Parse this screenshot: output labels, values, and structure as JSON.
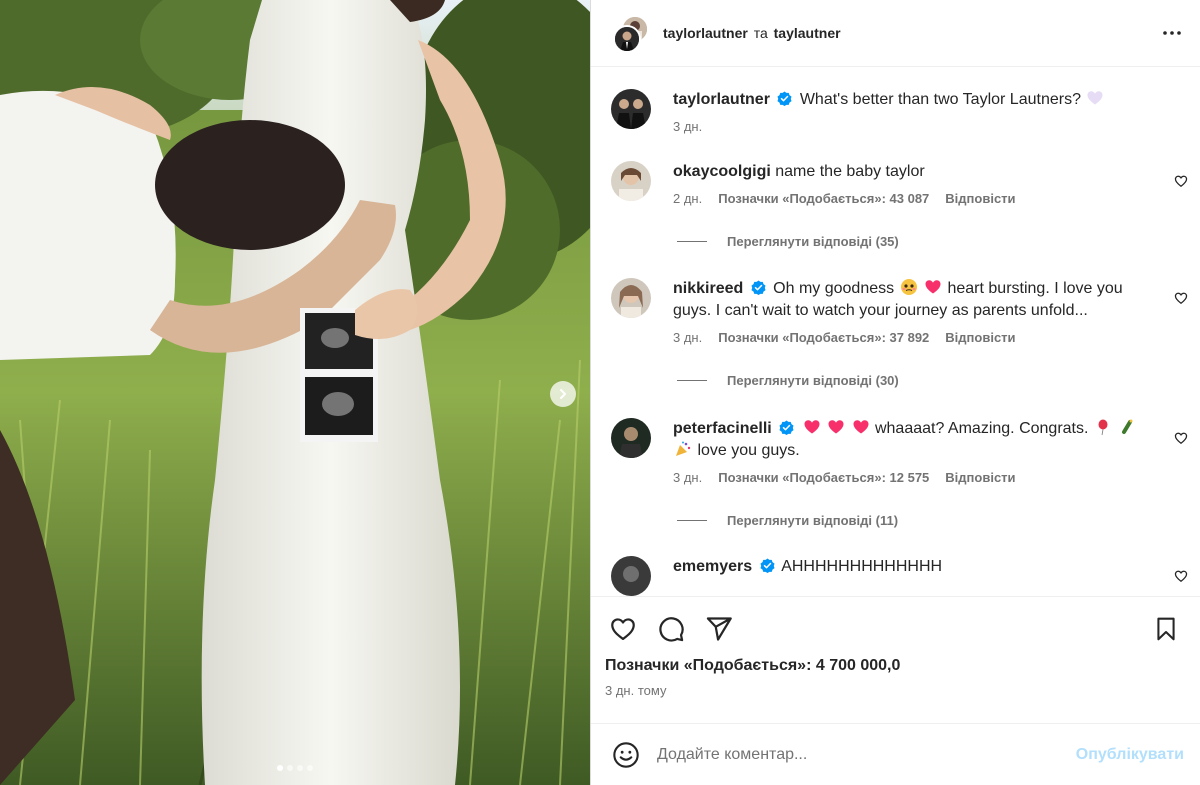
{
  "header": {
    "user1": "taylorlautner",
    "conjunction": "та",
    "user2": "taylautner",
    "more_icon": "more-horizontal-icon"
  },
  "caption": {
    "username": "taylorlautner",
    "text": "What's better than two Taylor Lautners?",
    "time": "3 дн."
  },
  "comments": [
    {
      "username": "okaycoolgigi",
      "verified": false,
      "text": "name the baby taylor",
      "time": "2 дн.",
      "likes": "Позначки «Подобається»: 43 087",
      "reply": "Відповісти",
      "view_replies": "Переглянути відповіді (35)"
    },
    {
      "username": "nikkireed",
      "verified": true,
      "text_part1": "Oh my goodness",
      "text_part2": "heart bursting. I love you guys. I can't wait to watch your journey as parents unfold...",
      "time": "3 дн.",
      "likes": "Позначки «Подобається»: 37 892",
      "reply": "Відповісти",
      "view_replies": "Переглянути відповіді (30)"
    },
    {
      "username": "peterfacinelli",
      "verified": true,
      "text_part1": "whaaaat? Amazing. Congrats.",
      "text_part2": "love you guys.",
      "time": "3 дн.",
      "likes": "Позначки «Подобається»: 12 575",
      "reply": "Відповісти",
      "view_replies": "Переглянути відповіді (11)"
    },
    {
      "username": "ememyers",
      "verified": true,
      "text": "AHHHHHHHHHHHHH"
    }
  ],
  "actions": {
    "like_icon": "heart-icon",
    "comment_icon": "comment-icon",
    "share_icon": "send-icon",
    "save_icon": "bookmark-icon",
    "likes": "Позначки «Подобається»: 4 700 000,0",
    "when": "3 дн. тому"
  },
  "add_comment": {
    "placeholder": "Додайте коментар...",
    "post": "Опублікувати"
  },
  "carousel": {
    "slides": 4,
    "active": 1
  },
  "colors": {
    "verified": "#0095f6",
    "heart": "#ff3040",
    "post_disabled": "#b2dffc",
    "muted": "#737373"
  }
}
